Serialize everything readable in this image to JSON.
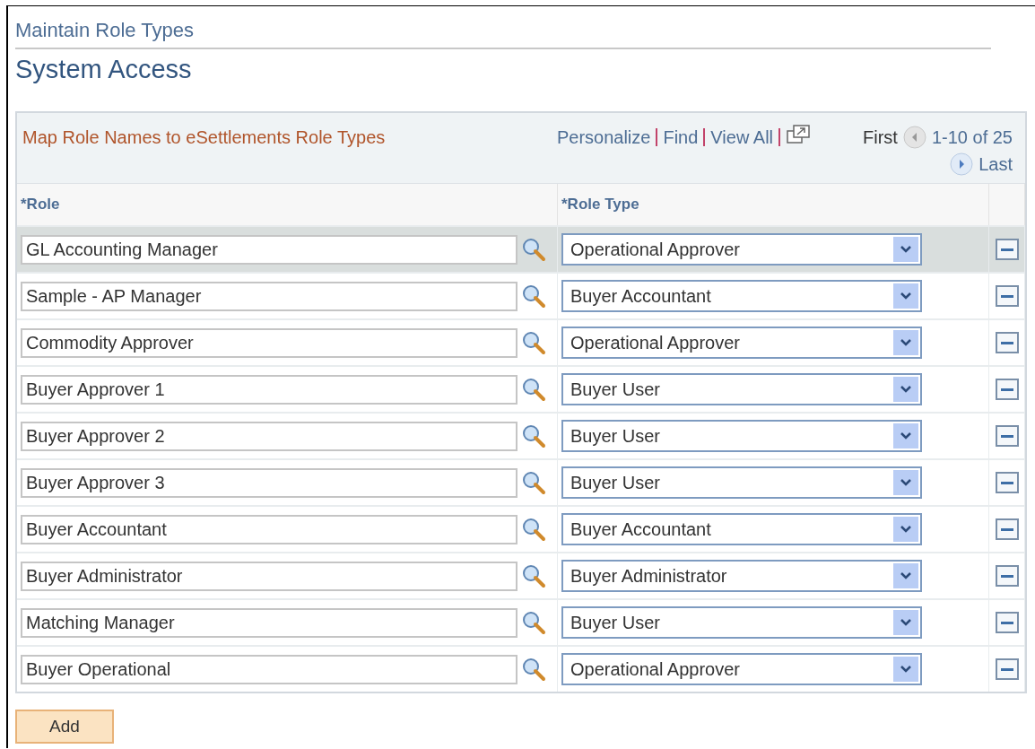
{
  "breadcrumb": "Maintain Role Types",
  "page_title": "System Access",
  "grid": {
    "title": "Map Role Names to eSettlements Role Types",
    "links": [
      "Personalize",
      "Find",
      "View All"
    ],
    "nav": {
      "first": "First",
      "range": "1-10 of 25",
      "last": "Last"
    },
    "columns": [
      "*Role",
      "*Role Type"
    ],
    "rows": [
      {
        "role": "GL Accounting Manager",
        "role_type": "Operational Approver",
        "selected": true
      },
      {
        "role": "Sample - AP Manager",
        "role_type": "Buyer Accountant",
        "selected": false
      },
      {
        "role": "Commodity Approver",
        "role_type": "Operational Approver",
        "selected": false
      },
      {
        "role": "Buyer Approver 1",
        "role_type": "Buyer User",
        "selected": false
      },
      {
        "role": "Buyer Approver 2",
        "role_type": "Buyer User",
        "selected": false
      },
      {
        "role": "Buyer Approver 3",
        "role_type": "Buyer User",
        "selected": false
      },
      {
        "role": "Buyer Accountant",
        "role_type": "Buyer Accountant",
        "selected": false
      },
      {
        "role": "Buyer Administrator",
        "role_type": "Buyer Administrator",
        "selected": false
      },
      {
        "role": "Matching Manager",
        "role_type": "Buyer User",
        "selected": false
      },
      {
        "role": "Buyer Operational",
        "role_type": "Operational Approver",
        "selected": false
      }
    ]
  },
  "add_button": "Add"
}
